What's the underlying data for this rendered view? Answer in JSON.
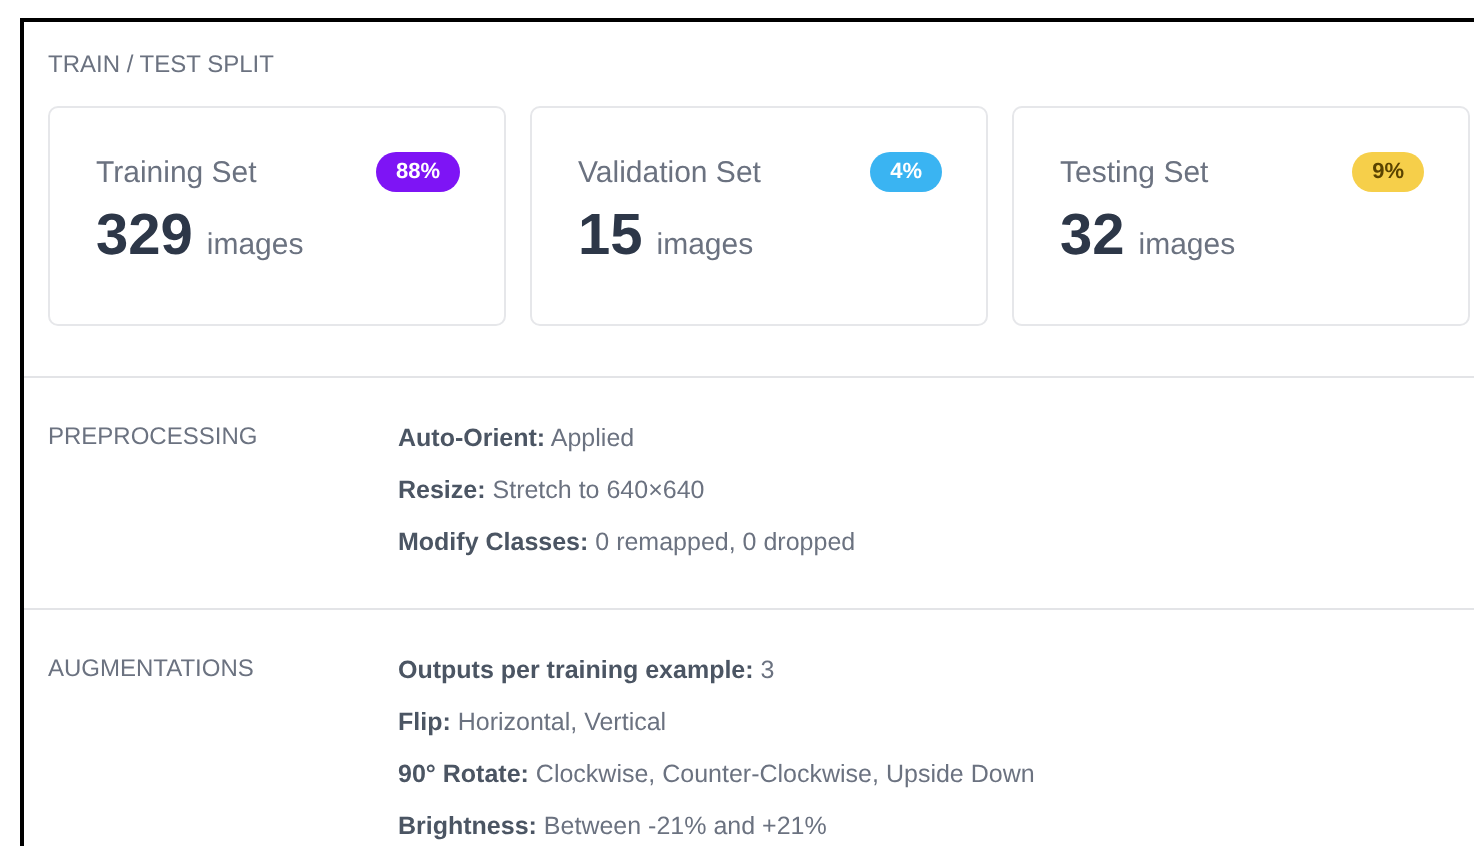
{
  "split": {
    "title": "TRAIN / TEST SPLIT",
    "cards": [
      {
        "label": "Training Set",
        "percent": "88%",
        "color": "#7e14f5",
        "count": "329",
        "unit": "images"
      },
      {
        "label": "Validation Set",
        "percent": "4%",
        "color": "#3ab4f2",
        "count": "15",
        "unit": "images"
      },
      {
        "label": "Testing Set",
        "percent": "9%",
        "color": "#f6cf4a",
        "count": "32",
        "unit": "images"
      }
    ]
  },
  "sections": [
    {
      "title": "PREPROCESSING",
      "lines": [
        "**Auto-Orient:** Applied",
        "**Resize:** Stretch to 640×640",
        "**Modify Classes:** 0 remapped, 0 dropped"
      ]
    },
    {
      "title": "AUGMENTATIONS",
      "lines": [
        "**Outputs per training example:** 3",
        "**Flip:** Horizontal, Vertical",
        "**90° Rotate:** Clockwise, Counter-Clockwise, Upside Down",
        "**Brightness:** Between -21% and +21%"
      ]
    }
  ]
}
